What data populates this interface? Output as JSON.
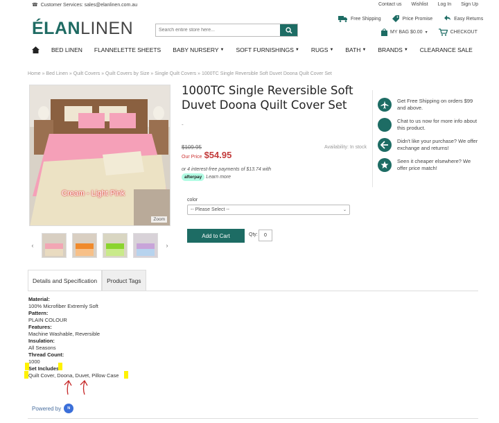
{
  "topbar": {
    "service_text": "Customer Services: sales@elanlinen.com.au",
    "links": [
      "Contact us",
      "Wishlist",
      "Log In",
      "Sign Up"
    ]
  },
  "brand": {
    "logo_a": "ÉLAN",
    "logo_b": "LINEN"
  },
  "search": {
    "placeholder": "Search entire store here..."
  },
  "perks": [
    "Free Shipping",
    "Price Promise",
    "Easy Returns"
  ],
  "cart": {
    "bag_label": "MY BAG $0.00",
    "checkout_label": "CHECKOUT"
  },
  "nav": {
    "items": [
      "BED LINEN",
      "FLANNELETTE SHEETS",
      "BABY NURSERY",
      "SOFT FURNISHINGS",
      "RUGS",
      "BATH",
      "BRANDS",
      "CLEARANCE SALE"
    ]
  },
  "breadcrumb": "Home » Bed Linen » Quilt Covers » Quilt Covers by Size » Single Quilt Covers » 1000TC Single Reversible Soft Duvet Doona Quilt Cover Set",
  "product": {
    "title": "1000TC Single Reversible Soft Duvet Doona Quilt Cover Set",
    "dash": "-",
    "old_price": "$109.95",
    "our_price_label": "Our Price",
    "our_price": "$54.95",
    "availability": "Availability: In stock",
    "afterpay_text": "or 4 interest-free payments of $13.74 with",
    "afterpay_badge": "afterpay",
    "learn_more": "Learn more",
    "image_caption": "Cream - Light Pink",
    "zoom_label": "Zoom",
    "color_label": "color",
    "color_select": "-- Please Select --",
    "add_to_cart": "Add to Cart",
    "qty_label": "Qty:",
    "qty_value": "0"
  },
  "benefits": [
    "Get Free Shipping on orders $99 and above.",
    "Chat to us now for more info about this product.",
    "Didn't like your purchase? We offer exchange and returns!",
    "Seen it cheaper elsewhere? We offer price match!"
  ],
  "tabs": [
    "Details and Specification",
    "Product Tags"
  ],
  "spec": {
    "material_h": "Material:",
    "material": "100% Microfiber Extremly Soft",
    "pattern_h": "Pattern:",
    "pattern": "PLAIN COLOUR",
    "features_h": "Features:",
    "features": "Machine Washable, Reversible",
    "insulation_h": "Insulation:",
    "insulation": "All Seasons",
    "thread_h": "Thread Count:",
    "thread": "1000",
    "set_h": "Set Includes:",
    "set": "Quilt Cover, Doona, Duvet, Pillow Case"
  },
  "footer": {
    "powered_by": "Powered by"
  },
  "colors": {
    "brand": "#1d6c64",
    "price": "#c23a3a",
    "highlight": "#fff200"
  }
}
